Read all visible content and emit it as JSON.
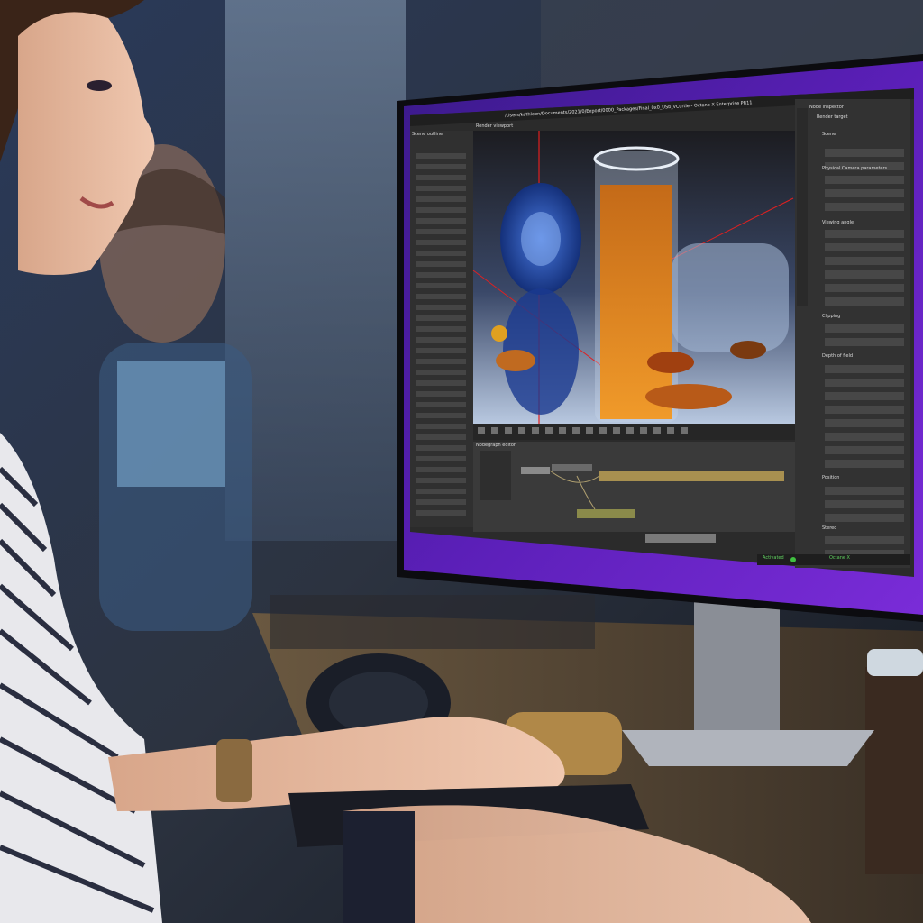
{
  "window": {
    "title": "/Users/kathleen/Documents/2021/0/Export/0000_Packages/Final_0x0_USb_vCurtle - Octane X Enterprise PR11"
  },
  "panes": {
    "scene_outliner": "Scene outliner",
    "render_viewport": "Render viewport",
    "node_inspector": "Node inspector",
    "node_graph": "Nodegraph editor"
  },
  "inspector": {
    "render_target": "Render target",
    "sections": [
      "Scene",
      "Physical Camera parameters",
      "Viewing angle",
      "Clipping",
      "Depth of field",
      "Position",
      "Stereo"
    ]
  },
  "status": {
    "activated": "Activated",
    "license": "Octane X"
  },
  "colors": {
    "purple_bezel": "#5b1fb8",
    "app_bg": "#2b2b2b",
    "panel_bg": "#3a3a3a",
    "accent_orange": "#c8741a"
  }
}
